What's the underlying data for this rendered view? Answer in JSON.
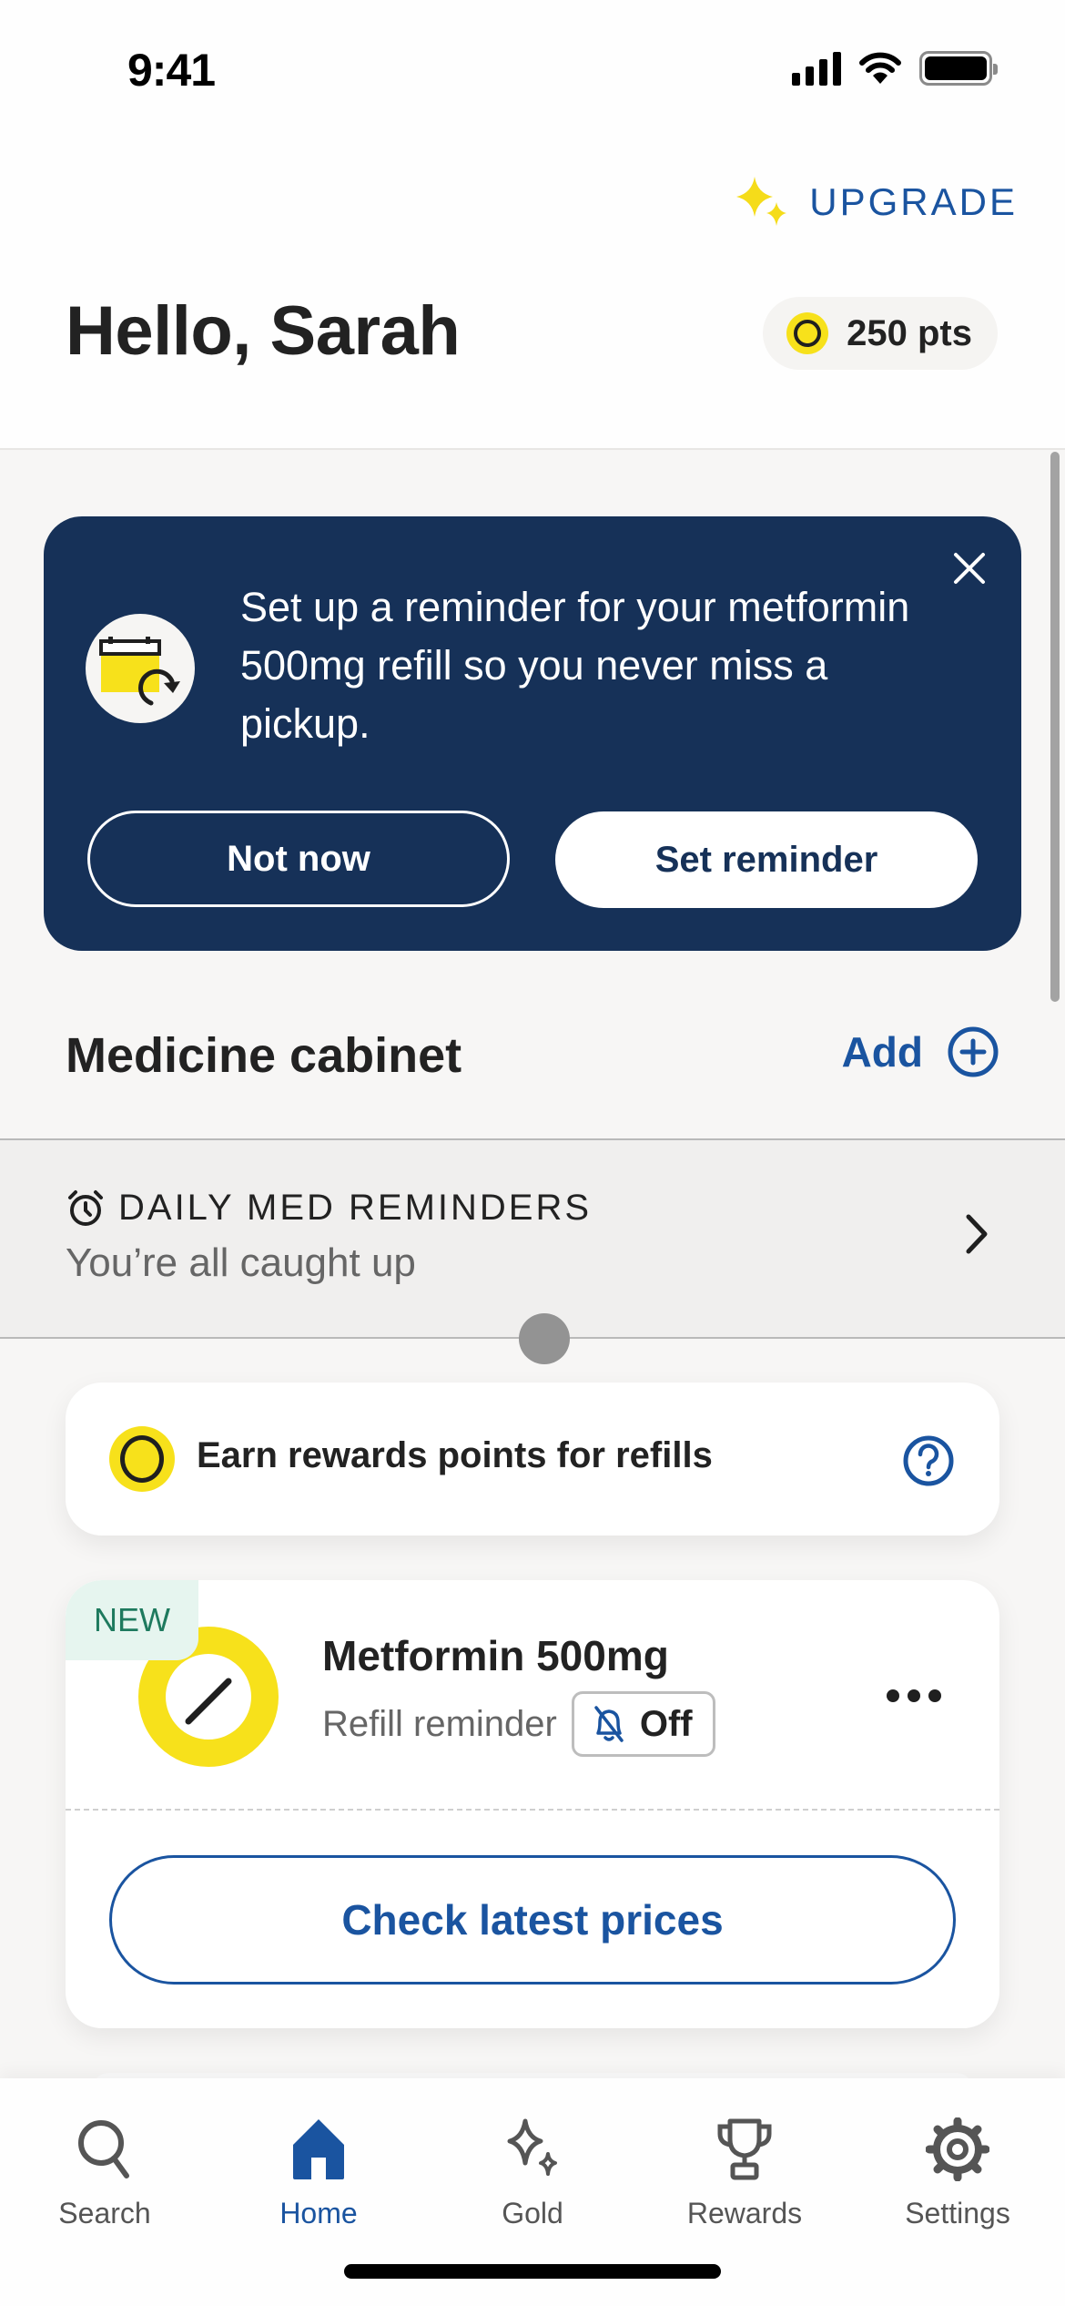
{
  "status_bar": {
    "time": "9:41"
  },
  "header": {
    "upgrade_label": "UPGRADE",
    "greeting": "Hello, Sarah",
    "points_label": "250 pts"
  },
  "banner": {
    "message": "Set up a reminder for your metformin 500mg refill so you never miss a pickup.",
    "secondary_button": "Not now",
    "primary_button": "Set reminder",
    "icon": "calendar-refresh-icon"
  },
  "medicine_cabinet": {
    "title": "Medicine cabinet",
    "add_label": "Add",
    "daily_reminders": {
      "title": "DAILY MED REMINDERS",
      "subtitle": "You’re all caught up"
    },
    "rewards_card": {
      "text": "Earn rewards points for refills"
    },
    "medications": [
      {
        "badge": "NEW",
        "name": "Metformin 500mg",
        "reminder_label": "Refill reminder",
        "reminder_state": "Off",
        "action_label": "Check latest prices"
      }
    ]
  },
  "tabbar": {
    "tabs": [
      {
        "label": "Search",
        "icon": "search-icon",
        "active": false
      },
      {
        "label": "Home",
        "icon": "home-icon",
        "active": true
      },
      {
        "label": "Gold",
        "icon": "sparkles-icon",
        "active": false
      },
      {
        "label": "Rewards",
        "icon": "trophy-icon",
        "active": false
      },
      {
        "label": "Settings",
        "icon": "gear-icon",
        "active": false
      }
    ]
  },
  "colors": {
    "brand_blue": "#1a54a0",
    "banner_navy": "#163158",
    "accent_yellow": "#f7e11b",
    "new_badge_green": "#1e7a5e"
  }
}
